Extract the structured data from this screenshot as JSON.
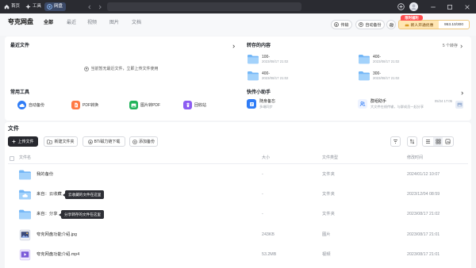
{
  "titlebar": {
    "tabs": [
      {
        "label": "首页",
        "icon": "home-icon"
      },
      {
        "label": "工具",
        "icon": "tools-icon"
      },
      {
        "label": "网盘",
        "icon": "cloud-drive-icon"
      }
    ]
  },
  "header": {
    "title": "夸克网盘",
    "tabs": [
      {
        "label": "全部"
      },
      {
        "label": "最近"
      },
      {
        "label": "视频"
      },
      {
        "label": "图片"
      },
      {
        "label": "文档"
      }
    ],
    "transfer_label": "传输",
    "backup_label": "自动备份",
    "promo_tag": "限时福利",
    "promo_label": "新人开通优惠",
    "storage_usage": "953.10/300"
  },
  "recent_files": {
    "title": "最近文件",
    "empty_text": "当前暂无最近文件，立即上传文件使用"
  },
  "saved_content": {
    "title": "转存的内容",
    "count_label": "5 个转存",
    "items": [
      {
        "name": "100-",
        "date": "2023/08/17 21:02"
      },
      {
        "name": "400-",
        "date": "2023/08/17 21:02"
      },
      {
        "name": "400-",
        "date": "2023/08/17 21:02"
      },
      {
        "name": "300-",
        "date": "2023/08/17 21:02"
      }
    ]
  },
  "tools": {
    "title": "常用工具",
    "items": [
      {
        "label": "自动备份",
        "icon": "cloud-backup-icon",
        "color": "#2f7cf6"
      },
      {
        "label": "PDF转换",
        "icon": "pdf-convert-icon",
        "color": "#ff7a45"
      },
      {
        "label": "图片转PDF",
        "icon": "image-to-pdf-icon",
        "color": "#21b35b"
      },
      {
        "label": "回收站",
        "icon": "recycle-bin-icon",
        "color": "#8c5cf2"
      }
    ]
  },
  "quick_transfer": {
    "title": "快传小助手",
    "items": [
      {
        "title": "随身备忘",
        "subtitle": "多端同步",
        "icon": "memo-icon"
      },
      {
        "title": "群组助手",
        "subtitle": "大文件在线传输，与群成员一起分享",
        "date": "05/24 17:05",
        "icon": "group-icon"
      }
    ]
  },
  "files": {
    "title": "文件",
    "toolbar": {
      "upload_label": "上传文件",
      "new_folder_label": "新建文件夹",
      "bt_download_label": "BT/磁力链下载",
      "add_backup_label": "添加备份"
    },
    "columns": {
      "name": "文件名",
      "size": "大小",
      "type": "文件类型",
      "modified": "修改时间"
    },
    "rows": [
      {
        "name": "我的备份",
        "size": "-",
        "type": "文件夹",
        "modified": "2024/01/12 10:07",
        "icon": "folder-icon"
      },
      {
        "name": "来自：云收藏",
        "tooltip": "云收藏的文件在这里",
        "size": "-",
        "type": "文件夹",
        "modified": "2023/12/04 08:59",
        "icon": "folder-icon"
      },
      {
        "name": "来自：分享",
        "tooltip": "分享转存的文件在这里",
        "size": "-",
        "type": "文件夹",
        "modified": "2023/08/17 21:02",
        "icon": "folder-icon"
      },
      {
        "name": "夸克网盘功能介绍.jpg",
        "size": "243KB",
        "type": "图片",
        "modified": "2023/08/17 21:01",
        "icon": "image-file-icon"
      },
      {
        "name": "夸克网盘功能介绍.mp4",
        "size": "53.2MB",
        "type": "视频",
        "modified": "2023/08/17 21:01",
        "icon": "video-file-icon"
      }
    ]
  },
  "colors": {
    "titlebar_bg": "#2a2b31",
    "accent": "#2f7cf6",
    "promo_tag": "#ff4d4f",
    "primary_button": "#27282e",
    "folder": "#74b7f7"
  }
}
